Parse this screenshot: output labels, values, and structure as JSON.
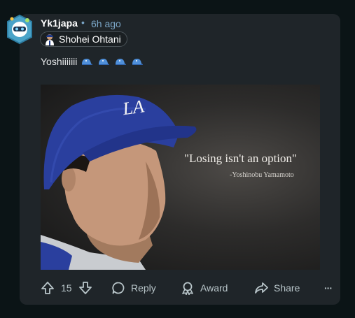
{
  "post": {
    "username": "Yk1japa",
    "separator": "•",
    "time": "6h ago",
    "flair": "Shohei Ohtani",
    "comment_text": "Yoshiiiiiii",
    "media": {
      "quote": "\"Losing isn't an option\"",
      "attribution": "-Yoshinobu Yamamoto",
      "cap_logo": "LA"
    }
  },
  "actions": {
    "vote_count": "15",
    "reply_label": "Reply",
    "award_label": "Award",
    "share_label": "Share",
    "more_label": "···"
  },
  "colors": {
    "background": "#0b1416",
    "card": "#1f2529",
    "accent_blue": "#7ba6c7",
    "action_text": "#b8c5c9",
    "dodger_blue": "#2a3f9e"
  }
}
